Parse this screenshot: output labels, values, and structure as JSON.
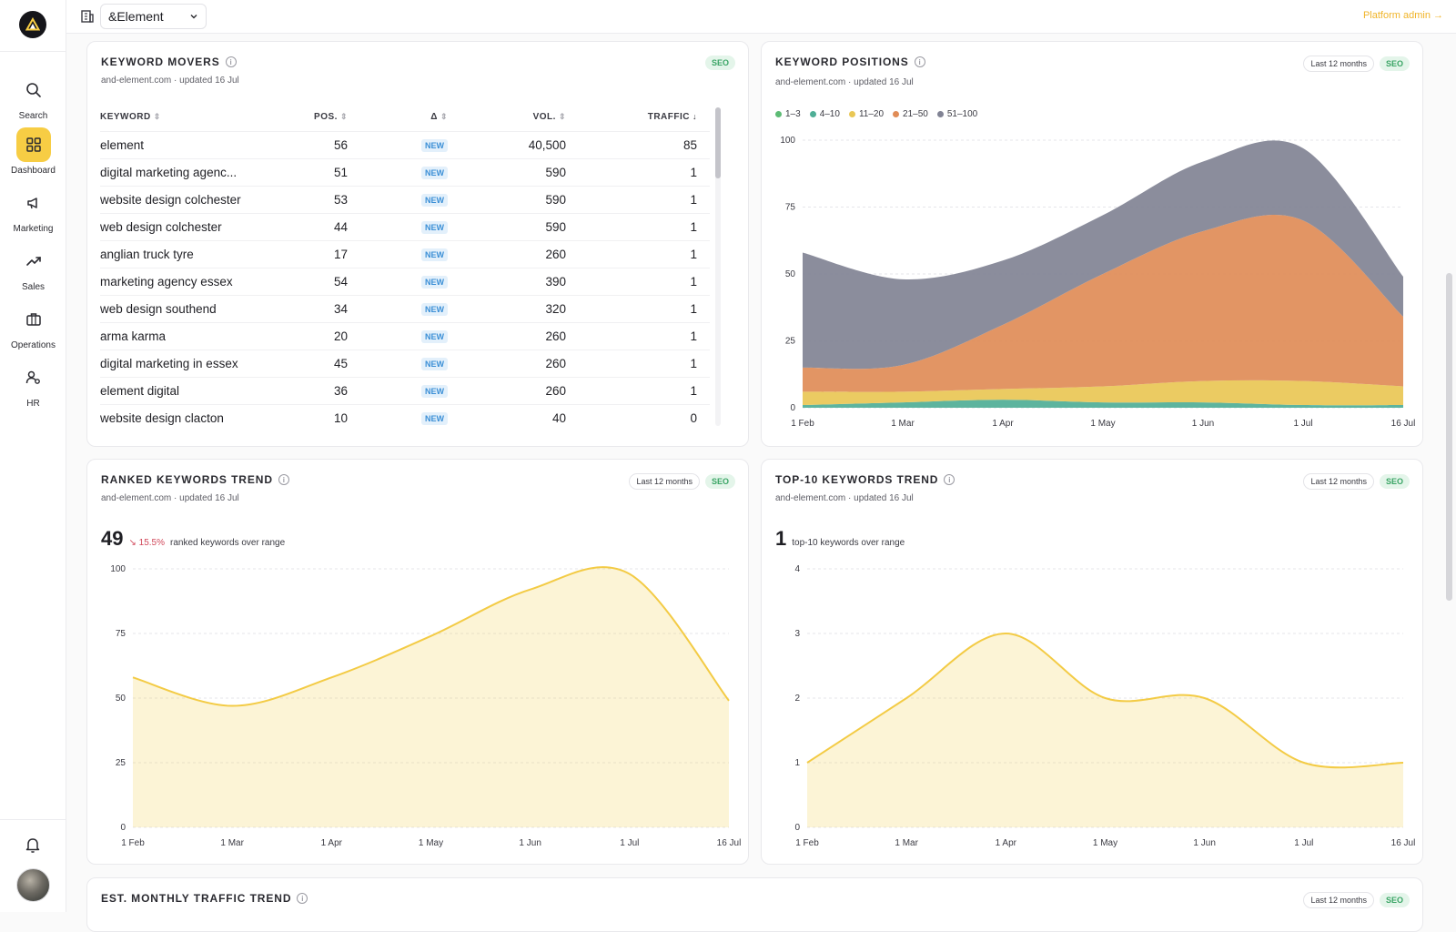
{
  "sidebar": {
    "items": [
      {
        "label": "Search",
        "icon": "search-icon"
      },
      {
        "label": "Dashboard",
        "icon": "dashboard-icon"
      },
      {
        "label": "Marketing",
        "icon": "megaphone-icon"
      },
      {
        "label": "Sales",
        "icon": "trending-up-icon"
      },
      {
        "label": "Operations",
        "icon": "briefcase-icon"
      },
      {
        "label": "HR",
        "icon": "people-icon"
      }
    ],
    "active_item": "Dashboard"
  },
  "topbar": {
    "org_selected": "&Element",
    "platform_admin": "Platform admin →"
  },
  "colors": {
    "accent_yellow": "#f7cd44",
    "seo_green": "#3aa565",
    "new_blue": "#3b8fd6",
    "delta_red": "#d1495b",
    "pos_1_3": "#5dbb75",
    "pos_4_10": "#4fae96",
    "pos_11_20": "#e9c755",
    "pos_21_50": "#e08c57",
    "pos_51_100": "#818394"
  },
  "keyword_movers": {
    "title": "KEYWORD MOVERS",
    "subtitle": "and-element.com · updated 16 Jul",
    "badge": "SEO",
    "columns": [
      "KEYWORD",
      "POS.",
      "Δ",
      "VOL.",
      "TRAFFIC"
    ],
    "sort_column": "TRAFFIC",
    "rows": [
      {
        "keyword": "element",
        "pos": "56",
        "delta": "NEW",
        "vol": "40,500",
        "traffic": "85"
      },
      {
        "keyword": "digital marketing agenc...",
        "pos": "51",
        "delta": "NEW",
        "vol": "590",
        "traffic": "1"
      },
      {
        "keyword": "website design colchester",
        "pos": "53",
        "delta": "NEW",
        "vol": "590",
        "traffic": "1"
      },
      {
        "keyword": "web design colchester",
        "pos": "44",
        "delta": "NEW",
        "vol": "590",
        "traffic": "1"
      },
      {
        "keyword": "anglian truck tyre",
        "pos": "17",
        "delta": "NEW",
        "vol": "260",
        "traffic": "1"
      },
      {
        "keyword": "marketing agency essex",
        "pos": "54",
        "delta": "NEW",
        "vol": "390",
        "traffic": "1"
      },
      {
        "keyword": "web design southend",
        "pos": "34",
        "delta": "NEW",
        "vol": "320",
        "traffic": "1"
      },
      {
        "keyword": "arma karma",
        "pos": "20",
        "delta": "NEW",
        "vol": "260",
        "traffic": "1"
      },
      {
        "keyword": "digital marketing in essex",
        "pos": "45",
        "delta": "NEW",
        "vol": "260",
        "traffic": "1"
      },
      {
        "keyword": "element digital",
        "pos": "36",
        "delta": "NEW",
        "vol": "260",
        "traffic": "1"
      },
      {
        "keyword": "website design clacton",
        "pos": "10",
        "delta": "NEW",
        "vol": "40",
        "traffic": "0"
      }
    ]
  },
  "keyword_positions": {
    "title": "KEYWORD POSITIONS",
    "subtitle": "and-element.com · updated 16 Jul",
    "range": "Last 12 months",
    "badge": "SEO"
  },
  "ranked_trend": {
    "title": "RANKED KEYWORDS TREND",
    "subtitle": "and-element.com · updated 16 Jul",
    "range": "Last 12 months",
    "badge": "SEO",
    "kpi_value": "49",
    "kpi_delta": "↘ 15.5%",
    "kpi_label": "ranked keywords over range"
  },
  "top10_trend": {
    "title": "TOP-10 KEYWORDS TREND",
    "subtitle": "and-element.com · updated 16 Jul",
    "range": "Last 12 months",
    "badge": "SEO",
    "kpi_value": "1",
    "kpi_label": "top-10 keywords over range"
  },
  "traffic_trend": {
    "title": "EST. MONTHLY TRAFFIC TREND",
    "range": "Last 12 months",
    "badge": "SEO"
  },
  "chart_data": [
    {
      "id": "positions",
      "type": "area",
      "stacked": true,
      "x": [
        "1 Feb",
        "1 Mar",
        "1 Apr",
        "1 May",
        "1 Jun",
        "1 Jul",
        "16 Jul"
      ],
      "y_ticks": [
        "0",
        "25",
        "50",
        "75",
        "100"
      ],
      "ylim": [
        0,
        100
      ],
      "series": [
        {
          "name": "1–3",
          "color": "#5dbb75",
          "values": [
            0,
            0,
            0,
            0,
            0,
            0,
            0
          ]
        },
        {
          "name": "4–10",
          "color": "#4fae96",
          "values": [
            1,
            2,
            3,
            2,
            2,
            1,
            1
          ]
        },
        {
          "name": "11–20",
          "color": "#e9c755",
          "values": [
            5,
            4,
            4,
            6,
            8,
            9,
            7
          ]
        },
        {
          "name": "21–50",
          "color": "#e08c57",
          "values": [
            9,
            10,
            24,
            42,
            56,
            60,
            26
          ]
        },
        {
          "name": "51–100",
          "color": "#818394",
          "values": [
            43,
            32,
            24,
            22,
            26,
            27,
            15
          ]
        }
      ],
      "legend": "top-left",
      "grid": true
    },
    {
      "id": "ranked",
      "type": "area",
      "x": [
        "1 Feb",
        "1 Mar",
        "1 Apr",
        "1 May",
        "1 Jun",
        "1 Jul",
        "16 Jul"
      ],
      "y_ticks": [
        "0",
        "25",
        "50",
        "75",
        "100"
      ],
      "ylim": [
        0,
        100
      ],
      "series": [
        {
          "color": "#f3cb45",
          "values": [
            58,
            47,
            58,
            74,
            92,
            98,
            49
          ]
        }
      ],
      "grid": true
    },
    {
      "id": "top10",
      "type": "area",
      "x": [
        "1 Feb",
        "1 Mar",
        "1 Apr",
        "1 May",
        "1 Jun",
        "1 Jul",
        "16 Jul"
      ],
      "y_ticks": [
        "0",
        "1",
        "2",
        "3",
        "4"
      ],
      "ylim": [
        0,
        4
      ],
      "series": [
        {
          "color": "#f3cb45",
          "values": [
            1,
            2,
            3,
            2,
            2,
            1,
            1
          ]
        }
      ],
      "grid": true
    }
  ]
}
